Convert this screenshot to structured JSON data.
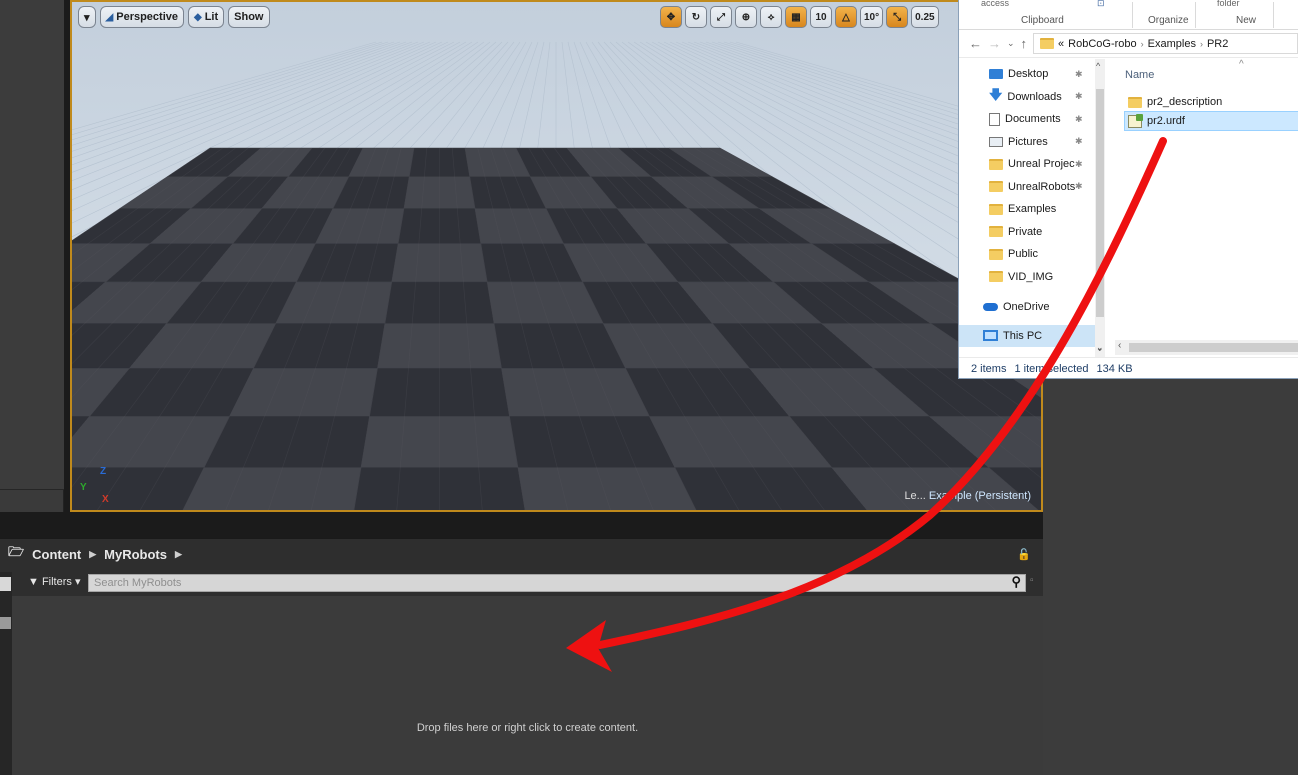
{
  "viewport": {
    "view_mode": "Perspective",
    "lighting": "Lit",
    "show": "Show",
    "grid_snap": "10",
    "angle_snap": "10°",
    "scale_snap": "0.25",
    "level_prefix": "Le...",
    "level_name": "Example (Persistent)",
    "axis_z": "Z",
    "axis_y": "Y",
    "axis_x": "X"
  },
  "explorer": {
    "ribbon": {
      "top1": "access",
      "top2": "folder",
      "group1": "Clipboard",
      "group2": "Organize",
      "group3": "New"
    },
    "breadcrumb": [
      "«",
      "RobCoG-robo",
      "Examples",
      "PR2"
    ],
    "nav_items": [
      {
        "label": "Desktop",
        "icon": "desktop-icon",
        "pinned": true
      },
      {
        "label": "Downloads",
        "icon": "download-icon",
        "pinned": true
      },
      {
        "label": "Documents",
        "icon": "documents-icon",
        "pinned": true
      },
      {
        "label": "Pictures",
        "icon": "pictures-icon",
        "pinned": true
      },
      {
        "label": "Unreal Projec",
        "icon": "folder-icon",
        "pinned": true
      },
      {
        "label": "UnrealRobots",
        "icon": "folder-icon",
        "pinned": true
      },
      {
        "label": "Examples",
        "icon": "folder-icon",
        "pinned": false
      },
      {
        "label": "Private",
        "icon": "folder-icon",
        "pinned": false
      },
      {
        "label": "Public",
        "icon": "folder-icon",
        "pinned": false
      },
      {
        "label": "VID_IMG",
        "icon": "folder-icon",
        "pinned": false
      }
    ],
    "onedrive": "OneDrive",
    "this_pc": "This PC",
    "column_name": "Name",
    "files": [
      {
        "name": "pr2_description",
        "type": "folder"
      },
      {
        "name": "pr2.urdf",
        "type": "urdf",
        "selected": true
      }
    ],
    "status": {
      "count": "2 items",
      "selection": "1 item selected",
      "size": "134 KB"
    }
  },
  "content_browser": {
    "path": [
      "Content",
      "MyRobots"
    ],
    "filters": "Filters",
    "search_placeholder": "Search MyRobots",
    "drop_hint": "Drop files here or right click to create content."
  },
  "colors": {
    "viewport_border": "#c08a1c",
    "arrow": "#ee1111",
    "selection": "#cce8ff"
  }
}
